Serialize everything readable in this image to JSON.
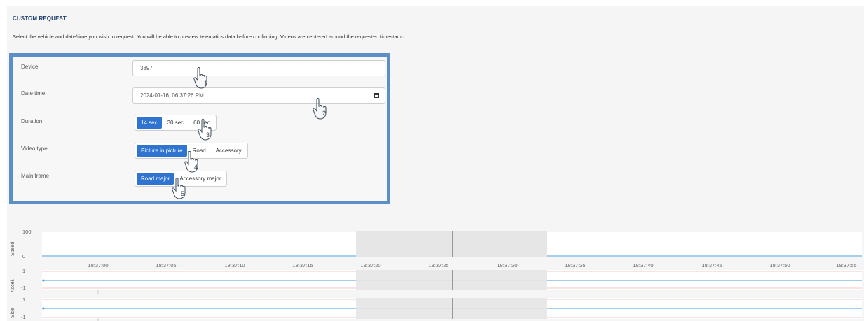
{
  "header": {
    "title": "CUSTOM REQUEST",
    "description": "Select the vehicle and date/time you wish to request. You will be able to preview telematics data before confirming. Videos are centered around the requested timestamp."
  },
  "form": {
    "device": {
      "label": "Device",
      "value": "3897"
    },
    "datetime": {
      "label": "Date time",
      "value": "2024-01-16, 06:37:26 PM"
    },
    "duration": {
      "label": "Duration",
      "options": [
        "14 sec",
        "30 sec",
        "60 sec"
      ],
      "selected": "14 sec"
    },
    "video_type": {
      "label": "Video type",
      "options": [
        "Picture in picture",
        "Road",
        "Accessory"
      ],
      "selected": "Picture in picture"
    },
    "main_frame": {
      "label": "Main frame",
      "options": [
        "Road major",
        "Accessory major"
      ],
      "selected": "Road major"
    }
  },
  "annotations": [
    "1",
    "2",
    "3",
    "4",
    "5"
  ],
  "charts": {
    "speed": {
      "label": "Speed",
      "ticks": [
        "100",
        "0"
      ]
    },
    "accel": {
      "label": "Accel.",
      "ticks": [
        "1",
        "-1"
      ]
    },
    "side": {
      "label": "Side",
      "ticks": [
        "1",
        "-1"
      ]
    },
    "x_ticks": [
      "18:37:00",
      "18:37:05",
      "18:37:10",
      "18:37:15",
      "18:37:20",
      "18:37:25",
      "18:37:30",
      "18:37:35",
      "18:37:40",
      "18:37:45",
      "18:37:50",
      "18:37:55"
    ]
  },
  "colors": {
    "accent": "#2f74d0",
    "highlight_border": "#5b8fc6",
    "title": "#1f3d6b",
    "selection_shade": "#e6e6e6",
    "series_line": "#4a9be0"
  }
}
